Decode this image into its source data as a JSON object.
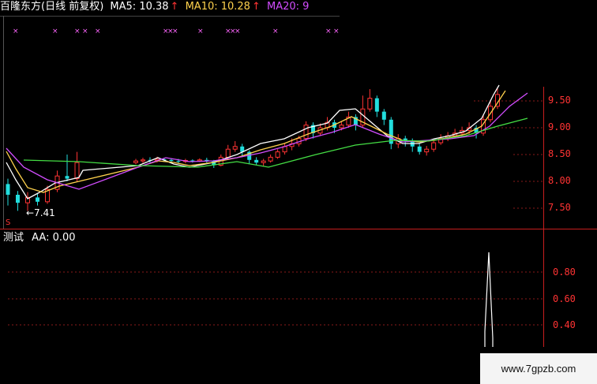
{
  "header": {
    "stock_title": "百隆东方(日线 前复权)",
    "ma5_label": "MA5: 10.38",
    "ma10_label": "MA10: 10.28",
    "ma20_label": "MA20: 9",
    "up_arrow": "↑",
    "colors": {
      "title": "#ffffff",
      "ma5": "#ffffff",
      "ma10": "#ffd24d",
      "ma20": "#d24dff",
      "arrow": "#ff3333"
    }
  },
  "price_axis": {
    "ticks": [
      "9.50",
      "9.00",
      "8.50",
      "8.00",
      "7.50"
    ]
  },
  "low_marker": "←7.41",
  "s_marker": "S",
  "indicator": {
    "title": "测试",
    "aa_label": "AA: 0.00",
    "ticks": [
      "0.80",
      "0.60",
      "0.40"
    ]
  },
  "watermark": "www.7gpzb.com",
  "chart_data": {
    "type": "candlestick",
    "ylim": [
      7.3,
      9.75
    ],
    "tick_values": [
      9.5,
      9.0,
      8.5,
      8.0,
      7.5
    ],
    "candles": [
      [
        7.95,
        7.75,
        8.05,
        7.55
      ],
      [
        7.75,
        7.6,
        7.82,
        7.45
      ],
      [
        7.6,
        7.7,
        7.8,
        7.45
      ],
      [
        7.7,
        7.62,
        7.78,
        7.55
      ],
      [
        7.62,
        7.85,
        7.92,
        7.58
      ],
      [
        7.85,
        8.1,
        8.2,
        7.8
      ],
      [
        8.1,
        8.05,
        8.5,
        8.0
      ],
      [
        8.05,
        8.35,
        8.55,
        8.0
      ],
      [
        8.35,
        8.38,
        8.42,
        8.32
      ],
      [
        8.38,
        8.4,
        8.44,
        8.34
      ],
      [
        8.4,
        8.39,
        8.45,
        8.35
      ],
      [
        8.39,
        8.41,
        8.46,
        8.35
      ],
      [
        8.41,
        8.4,
        8.44,
        8.36
      ],
      [
        8.4,
        8.38,
        8.43,
        8.34
      ],
      [
        8.38,
        8.37,
        8.42,
        8.33
      ],
      [
        8.37,
        8.39,
        8.42,
        8.34
      ],
      [
        8.39,
        8.38,
        8.41,
        8.35
      ],
      [
        8.38,
        8.4,
        8.43,
        8.36
      ],
      [
        8.4,
        8.38,
        8.44,
        8.35
      ],
      [
        8.38,
        8.3,
        8.4,
        8.25
      ],
      [
        8.3,
        8.45,
        8.5,
        8.28
      ],
      [
        8.45,
        8.6,
        8.68,
        8.42
      ],
      [
        8.6,
        8.65,
        8.75,
        8.55
      ],
      [
        8.65,
        8.55,
        8.7,
        8.45
      ],
      [
        8.55,
        8.4,
        8.58,
        8.32
      ],
      [
        8.4,
        8.35,
        8.45,
        8.3
      ],
      [
        8.35,
        8.38,
        8.42,
        8.28
      ],
      [
        8.38,
        8.45,
        8.5,
        8.35
      ],
      [
        8.45,
        8.55,
        8.6,
        8.42
      ],
      [
        8.55,
        8.65,
        8.72,
        8.5
      ],
      [
        8.65,
        8.7,
        8.8,
        8.58
      ],
      [
        8.7,
        8.8,
        8.85,
        8.65
      ],
      [
        8.8,
        9.05,
        9.12,
        8.75
      ],
      [
        9.05,
        8.9,
        9.1,
        8.8
      ],
      [
        8.9,
        9.0,
        9.08,
        8.85
      ],
      [
        9.0,
        9.1,
        9.2,
        8.95
      ],
      [
        9.1,
        9.0,
        9.15,
        8.9
      ],
      [
        9.0,
        9.05,
        9.12,
        8.95
      ],
      [
        9.05,
        9.2,
        9.3,
        9.0
      ],
      [
        9.2,
        9.05,
        9.25,
        8.95
      ],
      [
        9.05,
        9.35,
        9.6,
        9.0
      ],
      [
        9.35,
        9.55,
        9.72,
        9.3
      ],
      [
        9.55,
        9.3,
        9.6,
        9.2
      ],
      [
        9.3,
        9.15,
        9.35,
        9.05
      ],
      [
        9.15,
        8.7,
        9.2,
        8.6
      ],
      [
        8.7,
        8.8,
        8.88,
        8.62
      ],
      [
        8.8,
        8.75,
        8.85,
        8.65
      ],
      [
        8.75,
        8.65,
        8.8,
        8.55
      ],
      [
        8.65,
        8.55,
        8.7,
        8.5
      ],
      [
        8.55,
        8.6,
        8.66,
        8.48
      ],
      [
        8.6,
        8.72,
        8.78,
        8.55
      ],
      [
        8.72,
        8.8,
        8.88,
        8.68
      ],
      [
        8.8,
        8.85,
        8.92,
        8.75
      ],
      [
        8.85,
        8.9,
        8.98,
        8.8
      ],
      [
        8.9,
        8.95,
        9.02,
        8.84
      ],
      [
        8.95,
        9.0,
        9.1,
        8.88
      ],
      [
        9.0,
        8.9,
        9.05,
        8.8
      ],
      [
        8.9,
        9.15,
        9.25,
        8.85
      ],
      [
        9.15,
        9.4,
        9.5,
        9.1
      ],
      [
        9.4,
        9.62,
        9.75,
        9.35
      ]
    ],
    "indicator_spike": {
      "ylim": [
        0.25,
        0.98
      ],
      "values": [
        0.35,
        0.95,
        0.3
      ]
    }
  }
}
